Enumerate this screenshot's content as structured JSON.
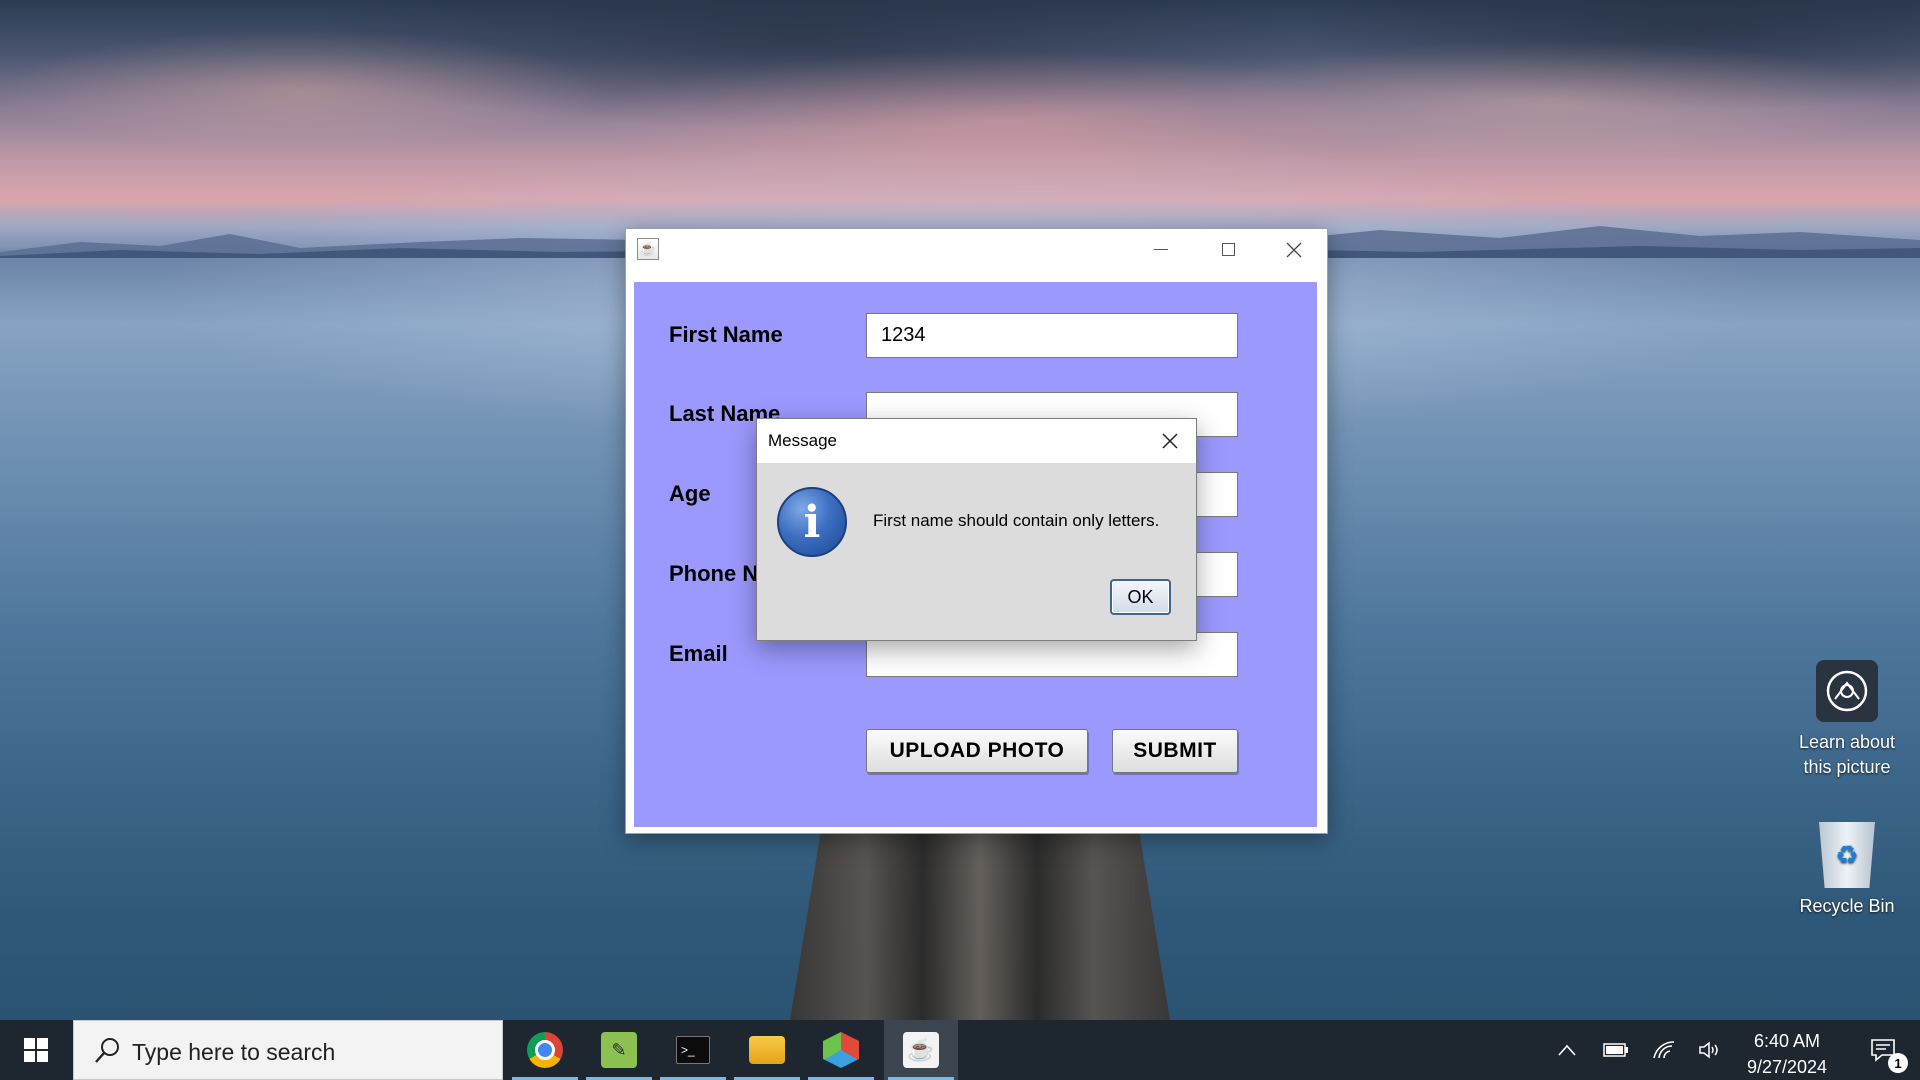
{
  "window": {
    "title": "",
    "form": {
      "first_name_label": "First Name",
      "first_name_value": "1234",
      "last_name_label": "Last Name",
      "last_name_value": "",
      "age_label": "Age",
      "age_value": "",
      "phone_label": "Phone No",
      "phone_value": "",
      "email_label": "Email",
      "email_value": "",
      "upload_button": "UPLOAD PHOTO",
      "submit_button": "SUBMIT"
    }
  },
  "dialog": {
    "title": "Message",
    "message": "First name should contain only letters.",
    "icon": "info-icon",
    "ok_label": "OK"
  },
  "desktop": {
    "icons": [
      {
        "label_line1": "Learn about",
        "label_line2": "this picture",
        "icon": "camera-icon"
      },
      {
        "label": "Recycle Bin",
        "icon": "recycle-bin-icon"
      }
    ]
  },
  "taskbar": {
    "search_placeholder": "Type here to search",
    "apps": [
      "chrome-icon",
      "notepad-plus-icon",
      "terminal-icon",
      "file-explorer-icon",
      "3d-viewer-icon",
      "java-icon"
    ],
    "time": "6:40 AM",
    "date": "9/27/2024",
    "notification_count": "1"
  },
  "colors": {
    "form_background": "#9b99fd",
    "taskbar": "#1e2730",
    "dialog_background": "#dcdcdc"
  }
}
